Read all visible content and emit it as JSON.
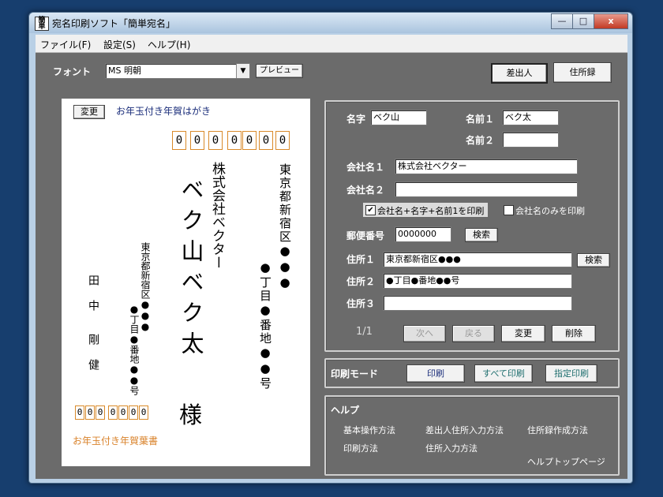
{
  "window": {
    "title": "宛名印刷ソフト「簡単宛名」",
    "icon_text": "簡単",
    "minimize": "—",
    "maximize": "□",
    "close": "x"
  },
  "menu": [
    "ファイル(F)",
    "設定(S)",
    "ヘルプ(H)"
  ],
  "toolbar": {
    "font_label": "フォント",
    "font_value": "MS 明朝",
    "preview_button": "プレビュー",
    "sender_button": "差出人",
    "addressbook_button": "住所録"
  },
  "card": {
    "change_button": "変更",
    "card_type": "お年玉付き年賀はがき",
    "recipient_zip": [
      "0",
      "0",
      "0",
      "0",
      "0",
      "0",
      "0"
    ],
    "recipient_address_line1": "東京都新宿区●●●",
    "recipient_address_line2": "●丁目●番地●●号",
    "recipient_company": "株式会社ベクター",
    "recipient_name": "ベク山ベク太",
    "honorific": "様",
    "sender_address_line1": "東京都新宿区●●●",
    "sender_address_line2": "●丁目●番地●●号",
    "sender_name_first": "田中",
    "sender_name_last": "剛健",
    "sender_zip": [
      "0",
      "0",
      "0",
      "0",
      "0",
      "0",
      "0"
    ],
    "footer_text": "お年玉付き年賀葉書"
  },
  "form": {
    "surname_label": "名字",
    "surname_value": "ベク山",
    "name1_label": "名前１",
    "name1_value": "ベク太",
    "name2_label": "名前２",
    "name2_value": "",
    "company1_label": "会社名１",
    "company1_value": "株式会社ベクター",
    "company2_label": "会社名２",
    "company2_value": "",
    "check1_label": "会社名+名字+名前1を印刷",
    "check1_checked": true,
    "check2_label": "会社名のみを印刷",
    "check2_checked": false,
    "zip_label": "郵便番号",
    "zip_value": "0000000",
    "search_button": "検索",
    "address1_label": "住所１",
    "address1_value": "東京都新宿区●●●",
    "address1_search": "検索",
    "address2_label": "住所２",
    "address2_value": "●丁目●番地●●号",
    "address3_label": "住所３",
    "address3_value": "",
    "page_indicator": "1/1",
    "next_button": "次へ",
    "back_button": "戻る",
    "change_button": "変更",
    "delete_button": "削除"
  },
  "print_mode": {
    "label": "印刷モード",
    "print_button": "印刷",
    "print_all_button": "すべて印刷",
    "print_selected_button": "指定印刷"
  },
  "help": {
    "label": "ヘルプ",
    "links": [
      "基本操作方法",
      "差出人住所入力方法",
      "住所録作成方法",
      "印刷方法",
      "住所入力方法",
      "ヘルプトップページ"
    ]
  }
}
